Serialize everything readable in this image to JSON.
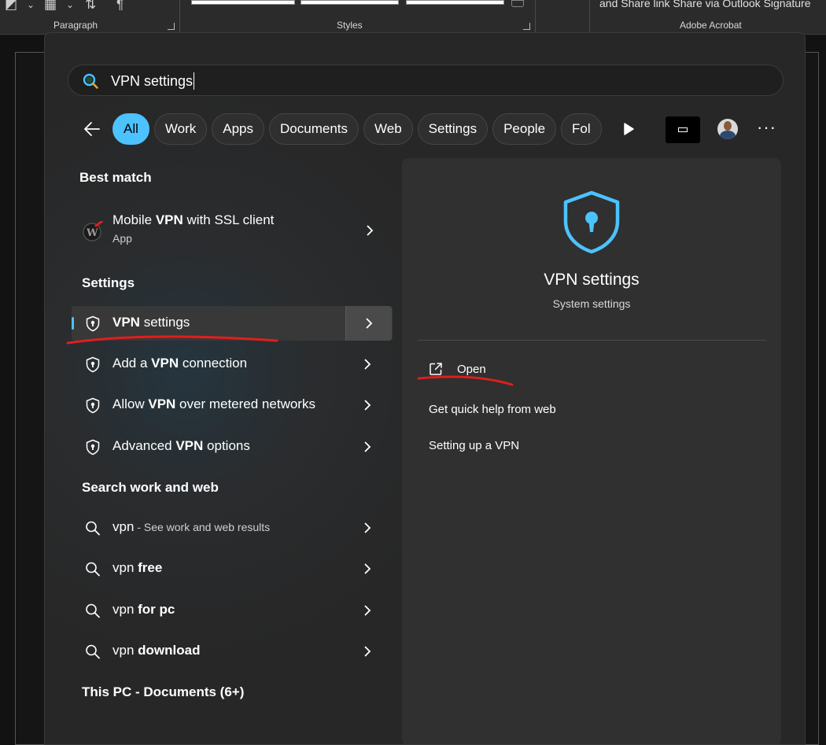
{
  "ribbon": {
    "paragraph_label": "Paragraph",
    "styles_label": "Styles",
    "acrobat_label": "Adobe Acrobat",
    "acrobat_text": "and Share link  Share via Outlook  Signature"
  },
  "search": {
    "query": "VPN settings"
  },
  "filters": {
    "chips": [
      "All",
      "Work",
      "Apps",
      "Documents",
      "Web",
      "Settings",
      "People",
      "Fol"
    ],
    "more_label": "···"
  },
  "sections": {
    "best_match": "Best match",
    "settings": "Settings",
    "search_web": "Search work and web",
    "this_pc": "This PC - Documents (6+)"
  },
  "best_match": {
    "name_pre": "Mobile ",
    "name_bold": "VPN",
    "name_post": " with SSL client",
    "type": "App"
  },
  "settings_results": [
    {
      "pre": "",
      "bold": "VPN",
      "post": " settings"
    },
    {
      "pre": "Add a ",
      "bold": "VPN",
      "post": " connection"
    },
    {
      "pre": "Allow ",
      "bold": "VPN",
      "post": " over metered networks"
    },
    {
      "pre": "Advanced ",
      "bold": "VPN",
      "post": " options"
    }
  ],
  "web_results": [
    {
      "pre": "vpn",
      "bold": "",
      "hint": " - See work and web results"
    },
    {
      "pre": "vpn ",
      "bold": "free",
      "hint": ""
    },
    {
      "pre": "vpn ",
      "bold": "for pc",
      "hint": ""
    },
    {
      "pre": "vpn ",
      "bold": "download",
      "hint": ""
    }
  ],
  "detail": {
    "title": "VPN settings",
    "subtitle": "System settings",
    "open": "Open",
    "help": "Get quick help from web",
    "setup": "Setting up a VPN"
  },
  "colors": {
    "accent": "#4cc2ff",
    "annotation": "#e01e1e"
  }
}
